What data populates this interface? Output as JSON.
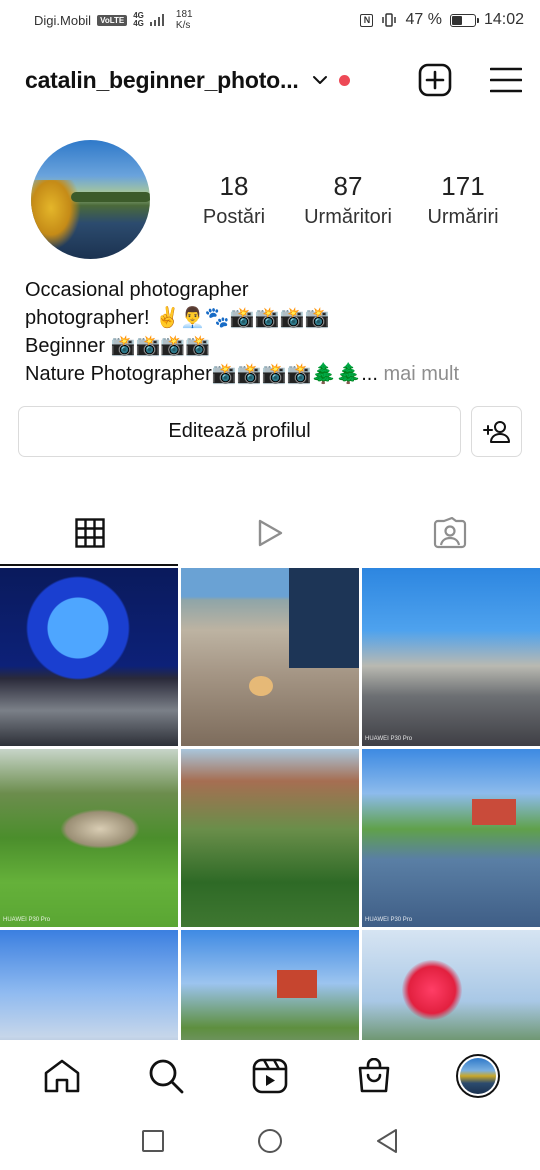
{
  "status_bar": {
    "carrier": "Digi.Mobil",
    "volte": "VoLTE",
    "network_type_top": "4G",
    "network_type_bottom": "4G",
    "speed_value": "181",
    "speed_unit": "K/s",
    "battery_percent": "47 %",
    "battery_level": 0.47,
    "time": "14:02"
  },
  "header": {
    "username": "catalin_beginner_photo...",
    "dropdown_icon": "chevron-down-icon",
    "notification_color": "#ed4956",
    "new_post_icon": "plus-square-icon",
    "menu_icon": "hamburger-menu-icon"
  },
  "profile": {
    "stats": [
      {
        "value": "18",
        "label": "Postări"
      },
      {
        "value": "87",
        "label": "Urmăritori"
      },
      {
        "value": "171",
        "label": "Urmăriri"
      }
    ],
    "bio": [
      "Occasional photographer",
      "photographer! ✌️👨‍💼🐾📸📸📸📸",
      "Beginner 📸📸📸📸",
      "Nature Photographer📸📸📸📸🌲🌲..."
    ],
    "more_label": "mai mult",
    "edit_label": "Editează profilul",
    "add_person_icon": "add-person-icon"
  },
  "tabs": [
    {
      "icon": "grid-icon",
      "active": true
    },
    {
      "icon": "reels-play-icon",
      "active": false
    },
    {
      "icon": "tagged-person-icon",
      "active": false
    }
  ],
  "photos": [
    {
      "caption": ""
    },
    {
      "caption": ""
    },
    {
      "caption": "HUAWEI P30 Pro"
    },
    {
      "caption": "HUAWEI P30 Pro"
    },
    {
      "caption": ""
    },
    {
      "caption": "HUAWEI P30 Pro"
    },
    {
      "caption": ""
    },
    {
      "caption": ""
    },
    {
      "caption": ""
    }
  ],
  "bottom_nav": [
    "home-icon",
    "search-icon",
    "reels-icon",
    "shop-icon",
    "profile-avatar"
  ],
  "system_nav": [
    "recents-square-icon",
    "home-circle-icon",
    "back-triangle-icon"
  ]
}
